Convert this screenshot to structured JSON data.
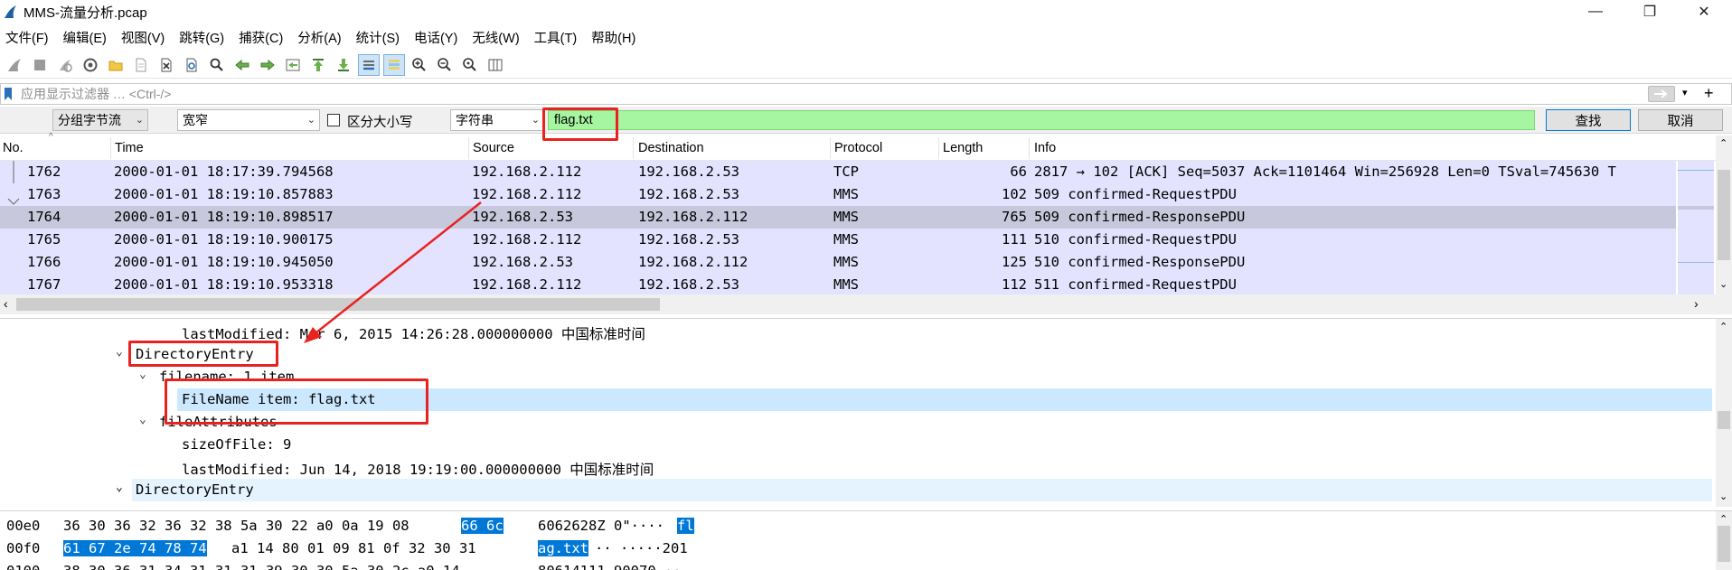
{
  "window": {
    "title": "MMS-流量分析.pcap",
    "controls": [
      "—",
      "❐",
      "✕"
    ]
  },
  "menu": [
    "文件(F)",
    "编辑(E)",
    "视图(V)",
    "跳转(G)",
    "捕获(C)",
    "分析(A)",
    "统计(S)",
    "电话(Y)",
    "无线(W)",
    "工具(T)",
    "帮助(H)"
  ],
  "display_filter": {
    "placeholder": "应用显示过滤器 … <Ctrl-/>"
  },
  "find_bar": {
    "search_in": "分组字节流",
    "char_width": "宽窄",
    "case_label": "区分大小写",
    "search_type": "字符串",
    "search_value": "flag.txt",
    "find_label": "查找",
    "cancel_label": "取消"
  },
  "packet_list": {
    "columns": [
      "No.",
      "Time",
      "Source",
      "Destination",
      "Protocol",
      "Length",
      "Info"
    ],
    "rows": [
      {
        "no": "1762",
        "time": "2000-01-01 18:17:39.794568",
        "src": "192.168.2.112",
        "dst": "192.168.2.53",
        "proto": "TCP",
        "len": "66",
        "info": "2817 → 102 [ACK] Seq=5037 Ack=1101464 Win=256928 Len=0 TSval=745630 T"
      },
      {
        "no": "1763",
        "time": "2000-01-01 18:19:10.857883",
        "src": "192.168.2.112",
        "dst": "192.168.2.53",
        "proto": "MMS",
        "len": "102",
        "info": "509 confirmed-RequestPDU"
      },
      {
        "no": "1764",
        "time": "2000-01-01 18:19:10.898517",
        "src": "192.168.2.53",
        "dst": "192.168.2.112",
        "proto": "MMS",
        "len": "765",
        "info": "509 confirmed-ResponsePDU"
      },
      {
        "no": "1765",
        "time": "2000-01-01 18:19:10.900175",
        "src": "192.168.2.112",
        "dst": "192.168.2.53",
        "proto": "MMS",
        "len": "111",
        "info": "510 confirmed-RequestPDU"
      },
      {
        "no": "1766",
        "time": "2000-01-01 18:19:10.945050",
        "src": "192.168.2.53",
        "dst": "192.168.2.112",
        "proto": "MMS",
        "len": "125",
        "info": "510 confirmed-ResponsePDU"
      },
      {
        "no": "1767",
        "time": "2000-01-01 18:19:10.953318",
        "src": "192.168.2.112",
        "dst": "192.168.2.53",
        "proto": "MMS",
        "len": "112",
        "info": "511 confirmed-RequestPDU"
      }
    ]
  },
  "detail_tree": [
    {
      "caret": "",
      "text": "lastModified: Mar  6, 2015 14:26:28.000000000 中国标准时间"
    },
    {
      "caret": "⌄",
      "text": "DirectoryEntry"
    },
    {
      "caret": "⌄",
      "text": "filename: 1 item"
    },
    {
      "caret": "",
      "text": "FileName item: flag.txt"
    },
    {
      "caret": "⌄",
      "text": "fileAttributes"
    },
    {
      "caret": "",
      "text": "sizeOfFile: 9"
    },
    {
      "caret": "",
      "text": "lastModified: Jun 14, 2018 19:19:00.000000000 中国标准时间"
    },
    {
      "caret": "⌄",
      "text": "DirectoryEntry"
    }
  ],
  "hex_dump": [
    {
      "offset": "00e0",
      "bytes_a": "36 30 36 32 36 32 38 5a  30 22 a0 0a 19 08",
      "bytes_sel": "66 6c",
      "bytes_b": "",
      "ascii_a": "6062628Z 0\"····",
      "ascii_sel": "fl",
      "ascii_b": ""
    },
    {
      "offset": "00f0",
      "bytes_a": "",
      "bytes_sel": "61 67 2e 74 78 74",
      "bytes_b": "a1 14  80 01 09 81 0f 32 30 31",
      "ascii_a": "",
      "ascii_sel": "ag.txt",
      "ascii_b": "·· ·····201"
    },
    {
      "offset": "0100",
      "bytes_a": "38 30 36 31 34 31 31 31  39 30 30 5a 30 2c a0 14",
      "bytes_sel": "",
      "bytes_b": "",
      "ascii_a": "80614111 90070 ··",
      "ascii_sel": "",
      "ascii_b": ""
    }
  ],
  "colors": {
    "row_bg": "#e3e3ff",
    "row_selected": "#c8c8dc",
    "find_input_bg": "#a6f5a0",
    "annotation_red": "#e8231f",
    "hex_selection": "#0078d7"
  }
}
